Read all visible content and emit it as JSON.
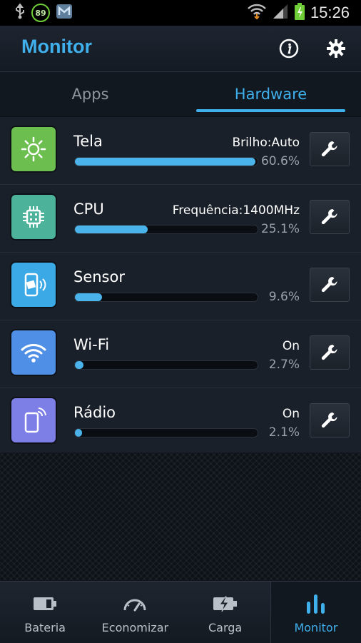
{
  "statusbar": {
    "badge_value": "89",
    "time": "15:26"
  },
  "header": {
    "title": "Monitor"
  },
  "tabs": [
    {
      "label": "Apps",
      "active": false
    },
    {
      "label": "Hardware",
      "active": true
    }
  ],
  "items": [
    {
      "name": "Tela",
      "detail": "Brilho:Auto",
      "percent_label": "60.6%",
      "percent": 60.6,
      "icon": "sun-icon",
      "color": "#6cbf4f"
    },
    {
      "name": "CPU",
      "detail": "Frequência:1400MHz",
      "percent_label": "25.1%",
      "percent": 25.1,
      "icon": "chip-icon",
      "color": "#4cb39a"
    },
    {
      "name": "Sensor",
      "detail": "",
      "percent_label": "9.6%",
      "percent": 9.6,
      "icon": "phone-sensor-icon",
      "color": "#3aa9e6"
    },
    {
      "name": "Wi-Fi",
      "detail": "On",
      "percent_label": "2.7%",
      "percent": 2.7,
      "icon": "wifi-icon",
      "color": "#4f8fe6"
    },
    {
      "name": "Rádio",
      "detail": "On",
      "percent_label": "2.1%",
      "percent": 2.1,
      "icon": "phone-radio-icon",
      "color": "#7d7fe6"
    }
  ],
  "nav": [
    {
      "label": "Bateria",
      "active": false,
      "icon": "battery-icon"
    },
    {
      "label": "Economizar",
      "active": false,
      "icon": "gauge-icon"
    },
    {
      "label": "Carga",
      "active": false,
      "icon": "charge-icon"
    },
    {
      "label": "Monitor",
      "active": true,
      "icon": "bars-icon"
    }
  ]
}
